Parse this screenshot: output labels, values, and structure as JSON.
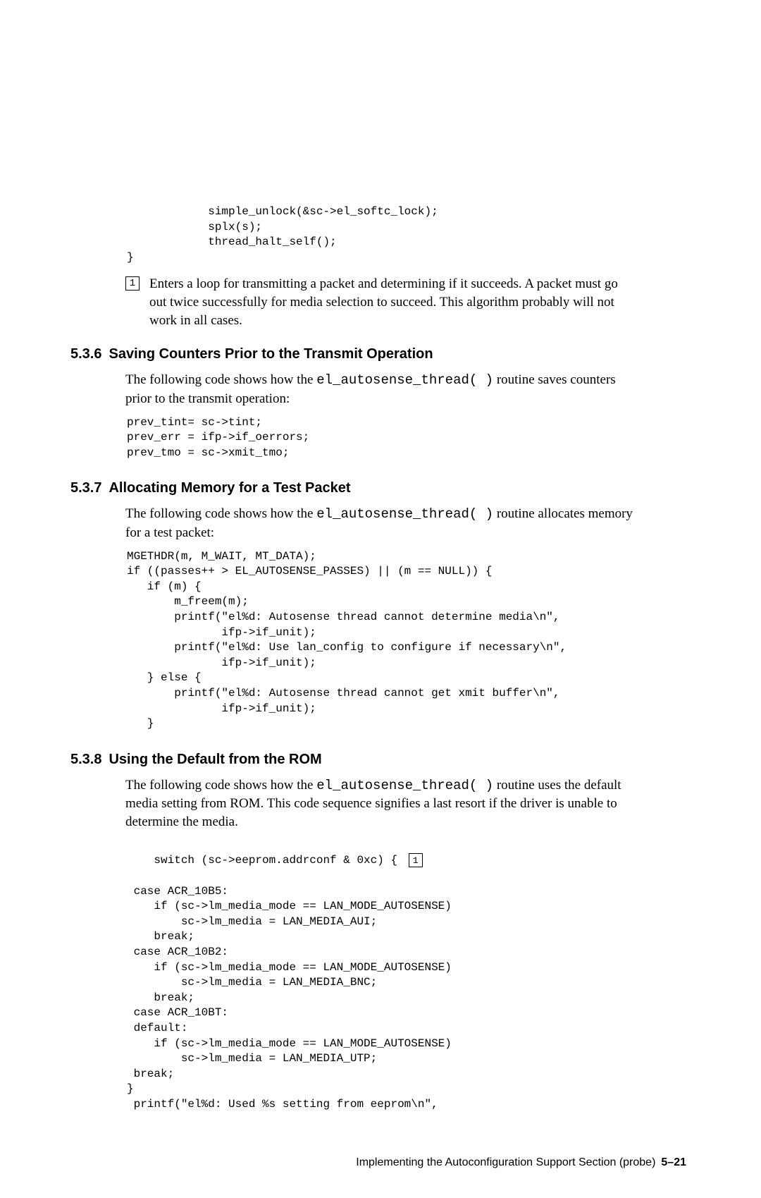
{
  "codeTop": "            simple_unlock(&sc->el_softc_lock);\n            splx(s);\n            thread_halt_self();\n}",
  "callout1": {
    "num": "1",
    "text": "Enters a loop for transmitting a packet and determining if it succeeds. A packet must go out twice successfully for media selection to succeed. This algorithm probably will not work in all cases."
  },
  "sec536": {
    "num": "5.3.6",
    "title": "Saving Counters Prior to the Transmit Operation",
    "para_pre": "The following code shows how the ",
    "para_code": "el_autosense_thread( )",
    "para_post": " routine saves counters prior to the transmit operation:",
    "code": "prev_tint= sc->tint;\nprev_err = ifp->if_oerrors;\nprev_tmo = sc->xmit_tmo;"
  },
  "sec537": {
    "num": "5.3.7",
    "title": "Allocating Memory for a Test Packet",
    "para_pre": "The following code shows how the ",
    "para_code": "el_autosense_thread( )",
    "para_post": " routine allocates memory for a test packet:",
    "code": "MGETHDR(m, M_WAIT, MT_DATA);\nif ((passes++ > EL_AUTOSENSE_PASSES) || (m == NULL)) {\n   if (m) {\n       m_freem(m);\n       printf(\"el%d: Autosense thread cannot determine media\\n\",\n              ifp->if_unit);\n       printf(\"el%d: Use lan_config to configure if necessary\\n\",\n              ifp->if_unit);\n   } else {\n       printf(\"el%d: Autosense thread cannot get xmit buffer\\n\",\n              ifp->if_unit);\n   }"
  },
  "sec538": {
    "num": "5.3.8",
    "title": "Using the Default from the ROM",
    "para_pre": "The following code shows how the ",
    "para_code": "el_autosense_thread( )",
    "para_post": " routine uses the default media setting from ROM. This code sequence signifies a last resort if the driver is unable to determine the media.",
    "code_line1": "switch (sc->eeprom.addrconf & 0xc) {",
    "callout_num": "1",
    "code_rest": " case ACR_10B5:\n    if (sc->lm_media_mode == LAN_MODE_AUTOSENSE)\n        sc->lm_media = LAN_MEDIA_AUI;\n    break;\n case ACR_10B2:\n    if (sc->lm_media_mode == LAN_MODE_AUTOSENSE)\n        sc->lm_media = LAN_MEDIA_BNC;\n    break;\n case ACR_10BT:\n default:\n    if (sc->lm_media_mode == LAN_MODE_AUTOSENSE)\n        sc->lm_media = LAN_MEDIA_UTP;\n break;\n}\n printf(\"el%d: Used %s setting from eeprom\\n\","
  },
  "footer": {
    "text": "Implementing the Autoconfiguration Support Section (probe)",
    "page": "5–21"
  }
}
